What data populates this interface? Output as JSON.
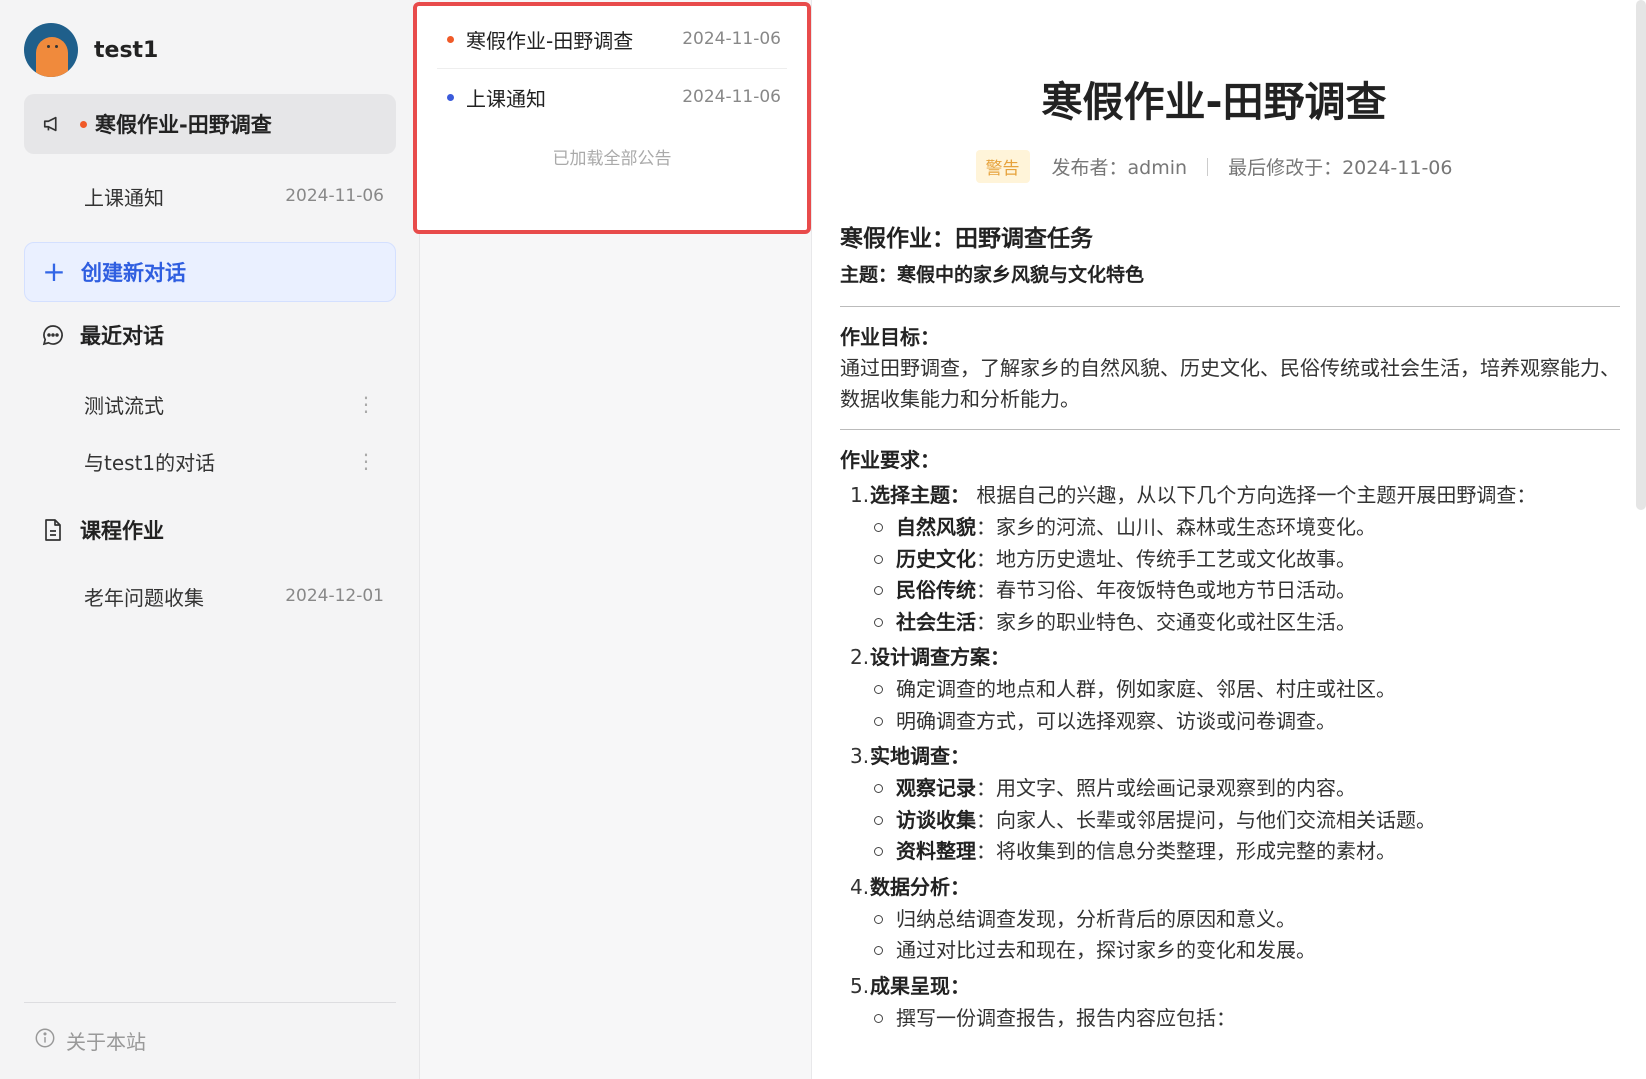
{
  "user": {
    "name": "test1"
  },
  "sidebar": {
    "notices": [
      {
        "label": "寒假作业-田野调查",
        "active": true
      },
      {
        "label": "上课通知",
        "date": "2024-11-06"
      }
    ],
    "create_label": "创建新对话",
    "recent_label": "最近对话",
    "conversations": [
      {
        "label": "测试流式"
      },
      {
        "label": "与test1的对话"
      }
    ],
    "homework_label": "课程作业",
    "homework_items": [
      {
        "label": "老年问题收集",
        "date": "2024-12-01"
      }
    ],
    "about_label": "关于本站"
  },
  "popup": {
    "items": [
      {
        "label": "寒假作业-田野调查",
        "date": "2024-11-06",
        "dot_color": "#f05a28"
      },
      {
        "label": "上课通知",
        "date": "2024-11-06",
        "dot_color": "#3b5bdb"
      }
    ],
    "loaded_text": "已加载全部公告"
  },
  "article": {
    "title": "寒假作业-田野调查",
    "tag": "警告",
    "publisher": "发布者：admin",
    "modified": "最后修改于：2024-11-06",
    "h1": "寒假作业：田野调查任务",
    "subtitle": "主题：寒假中的家乡风貌与文化特色",
    "goal_title": "作业目标：",
    "goal_text": "通过田野调查，了解家乡的自然风貌、历史文化、民俗传统或社会生活，培养观察能力、数据收集能力和分析能力。",
    "req_title": "作业要求：",
    "steps": [
      {
        "num": "1.",
        "title": "选择主题：",
        "text": " 根据自己的兴趣，从以下几个方向选择一个主题开展田野调查：",
        "subs": [
          {
            "title": "自然风貌",
            "text": "：家乡的河流、山川、森林或生态环境变化。"
          },
          {
            "title": "历史文化",
            "text": "：地方历史遗址、传统手工艺或文化故事。"
          },
          {
            "title": "民俗传统",
            "text": "：春节习俗、年夜饭特色或地方节日活动。"
          },
          {
            "title": "社会生活",
            "text": "：家乡的职业特色、交通变化或社区生活。"
          }
        ]
      },
      {
        "num": "2.",
        "title": "设计调查方案：",
        "text": "",
        "subs": [
          {
            "title": "",
            "text": "确定调查的地点和人群，例如家庭、邻居、村庄或社区。"
          },
          {
            "title": "",
            "text": "明确调查方式，可以选择观察、访谈或问卷调查。"
          }
        ]
      },
      {
        "num": "3.",
        "title": "实地调查：",
        "text": "",
        "subs": [
          {
            "title": "观察记录",
            "text": "：用文字、照片或绘画记录观察到的内容。"
          },
          {
            "title": "访谈收集",
            "text": "：向家人、长辈或邻居提问，与他们交流相关话题。"
          },
          {
            "title": "资料整理",
            "text": "：将收集到的信息分类整理，形成完整的素材。"
          }
        ]
      },
      {
        "num": "4.",
        "title": "数据分析：",
        "text": "",
        "subs": [
          {
            "title": "",
            "text": "归纳总结调查发现，分析背后的原因和意义。"
          },
          {
            "title": "",
            "text": "通过对比过去和现在，探讨家乡的变化和发展。"
          }
        ]
      },
      {
        "num": "5.",
        "title": "成果呈现：",
        "text": "",
        "subs": [
          {
            "title": "",
            "text": "撰写一份调查报告，报告内容应包括："
          }
        ]
      }
    ]
  }
}
